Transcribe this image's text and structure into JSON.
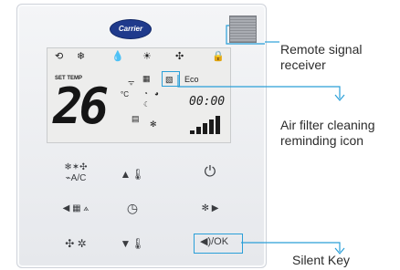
{
  "panel": {
    "logo_text": "Carrier",
    "lcd": {
      "set_temp_label": "SET TEMP",
      "temperature": "26",
      "unit": "°C",
      "eco_label": "Eco",
      "clock": "00:00"
    },
    "silent_key_label": "◀)/OK"
  },
  "annotations": {
    "remote_signal": [
      "Remote signal",
      "receiver"
    ],
    "air_filter": [
      "Air filter cleaning",
      "reminding icon"
    ],
    "silent_key": "Silent Key"
  },
  "colors": {
    "leader_line": "#2a9fd8",
    "brand": "#1f3a8c"
  },
  "icons": [
    "mode-icon",
    "fan-speed-icon",
    "swing-icon",
    "timer-icon",
    "power-icon",
    "lock-icon"
  ]
}
